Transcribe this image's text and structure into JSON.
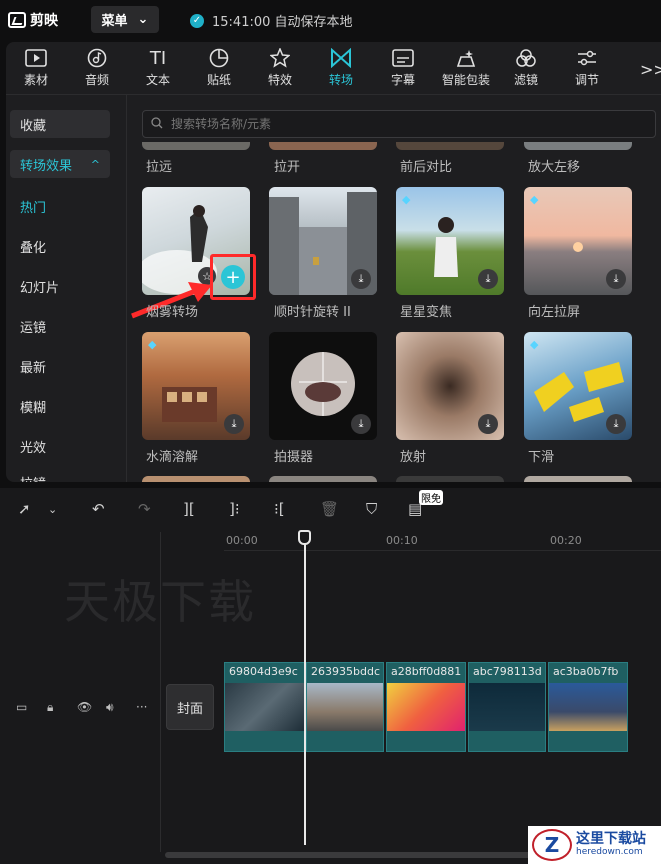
{
  "app": {
    "name": "剪映",
    "menu_label": "菜单",
    "save_status": "15:41:00 自动保存本地"
  },
  "toolbar": [
    {
      "label": "素材",
      "icon": "media-icon"
    },
    {
      "label": "音频",
      "icon": "audio-icon"
    },
    {
      "label": "文本",
      "icon": "text-icon"
    },
    {
      "label": "贴纸",
      "icon": "sticker-icon"
    },
    {
      "label": "特效",
      "icon": "effects-icon"
    },
    {
      "label": "转场",
      "icon": "transition-icon",
      "active": true
    },
    {
      "label": "字幕",
      "icon": "subtitle-icon"
    },
    {
      "label": "智能包装",
      "icon": "smart-package-icon"
    },
    {
      "label": "滤镜",
      "icon": "filter-icon"
    },
    {
      "label": "调节",
      "icon": "adjust-icon"
    }
  ],
  "toolbar_more": ">>",
  "sidebar": {
    "favorites": "收藏",
    "category": "转场效果",
    "items": [
      "热门",
      "叠化",
      "幻灯片",
      "运镜",
      "最新",
      "模糊",
      "光效",
      "拉镜"
    ]
  },
  "search": {
    "placeholder": "搜索转场名称/元素"
  },
  "top_row_labels": [
    "拉远",
    "拉开",
    "前后对比",
    "放大左移"
  ],
  "grid": [
    {
      "label": "烟雾转场"
    },
    {
      "label": "顺时针旋转 II"
    },
    {
      "label": "星星变焦"
    },
    {
      "label": "向左拉屏"
    },
    {
      "label": "水滴溶解"
    },
    {
      "label": "拍摄器"
    },
    {
      "label": "放射"
    },
    {
      "label": "下滑"
    }
  ],
  "timeline": {
    "free_badge": "限免",
    "ruler": [
      "00:00",
      "00:10",
      "00:20"
    ],
    "watermark": "天极下载",
    "cover_label": "封面",
    "clips": [
      "69804d3e9c",
      "263935bddc",
      "a28bff0d881",
      "abc798113d",
      "ac3ba0b7fb"
    ]
  },
  "site_logo": {
    "title": "这里下载站",
    "url": "heredown.com",
    "mark": "Z"
  },
  "colors": {
    "accent": "#2bc5d6",
    "highlight": "#ff2a2a",
    "clip": "#1f5f62"
  }
}
